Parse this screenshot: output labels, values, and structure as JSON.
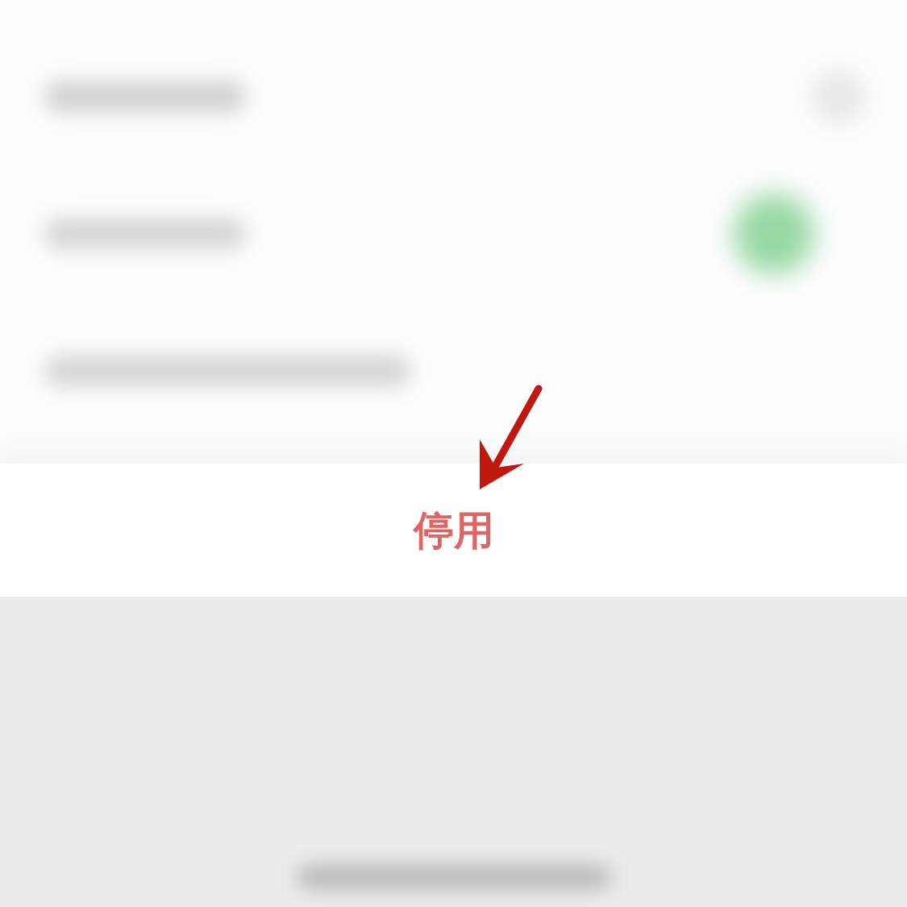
{
  "action_sheet": {
    "options": [
      {
        "label": "停用",
        "kind": "destructive"
      }
    ]
  }
}
